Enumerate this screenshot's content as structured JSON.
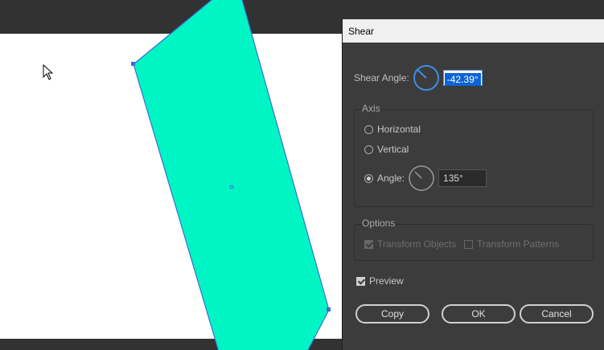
{
  "dialog": {
    "title": "Shear",
    "shear_angle_label": "Shear Angle:",
    "shear_angle_value": "-42.39°",
    "axis": {
      "title": "Axis",
      "options": [
        "Horizontal",
        "Vertical",
        "Angle:"
      ],
      "selected": "Angle:",
      "angle_value": "135°"
    },
    "options": {
      "title": "Options",
      "transform_objects": "Transform Objects",
      "transform_patterns": "Transform Patterns"
    },
    "preview_label": "Preview",
    "buttons": {
      "copy": "Copy",
      "ok": "OK",
      "cancel": "Cancel"
    }
  },
  "colors": {
    "shape_fill": "#00f5c4",
    "selection": "#3b6fd6",
    "dialog_bg": "#3c3c3c",
    "canvas_bg": "#323232"
  }
}
